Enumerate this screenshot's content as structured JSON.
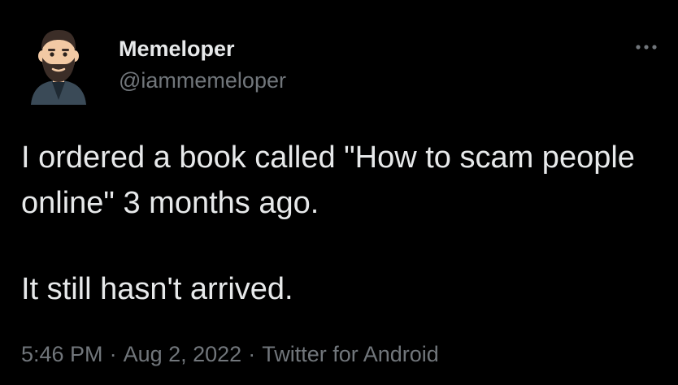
{
  "author": {
    "display_name": "Memeloper",
    "handle": "@iammemeloper",
    "avatar_icon": "bearded-man-avatar-icon"
  },
  "more_icon": "more-options-icon",
  "tweet": {
    "paragraphs": [
      "I ordered a book called \"How to scam people online\" 3 months ago.",
      "It still hasn't arrived."
    ]
  },
  "meta": {
    "time": "5:46 PM",
    "separator": "·",
    "date": "Aug 2, 2022",
    "source": "Twitter for Android"
  },
  "colors": {
    "background": "#000000",
    "primary_text": "#e7e9ea",
    "secondary_text": "#71767b"
  }
}
